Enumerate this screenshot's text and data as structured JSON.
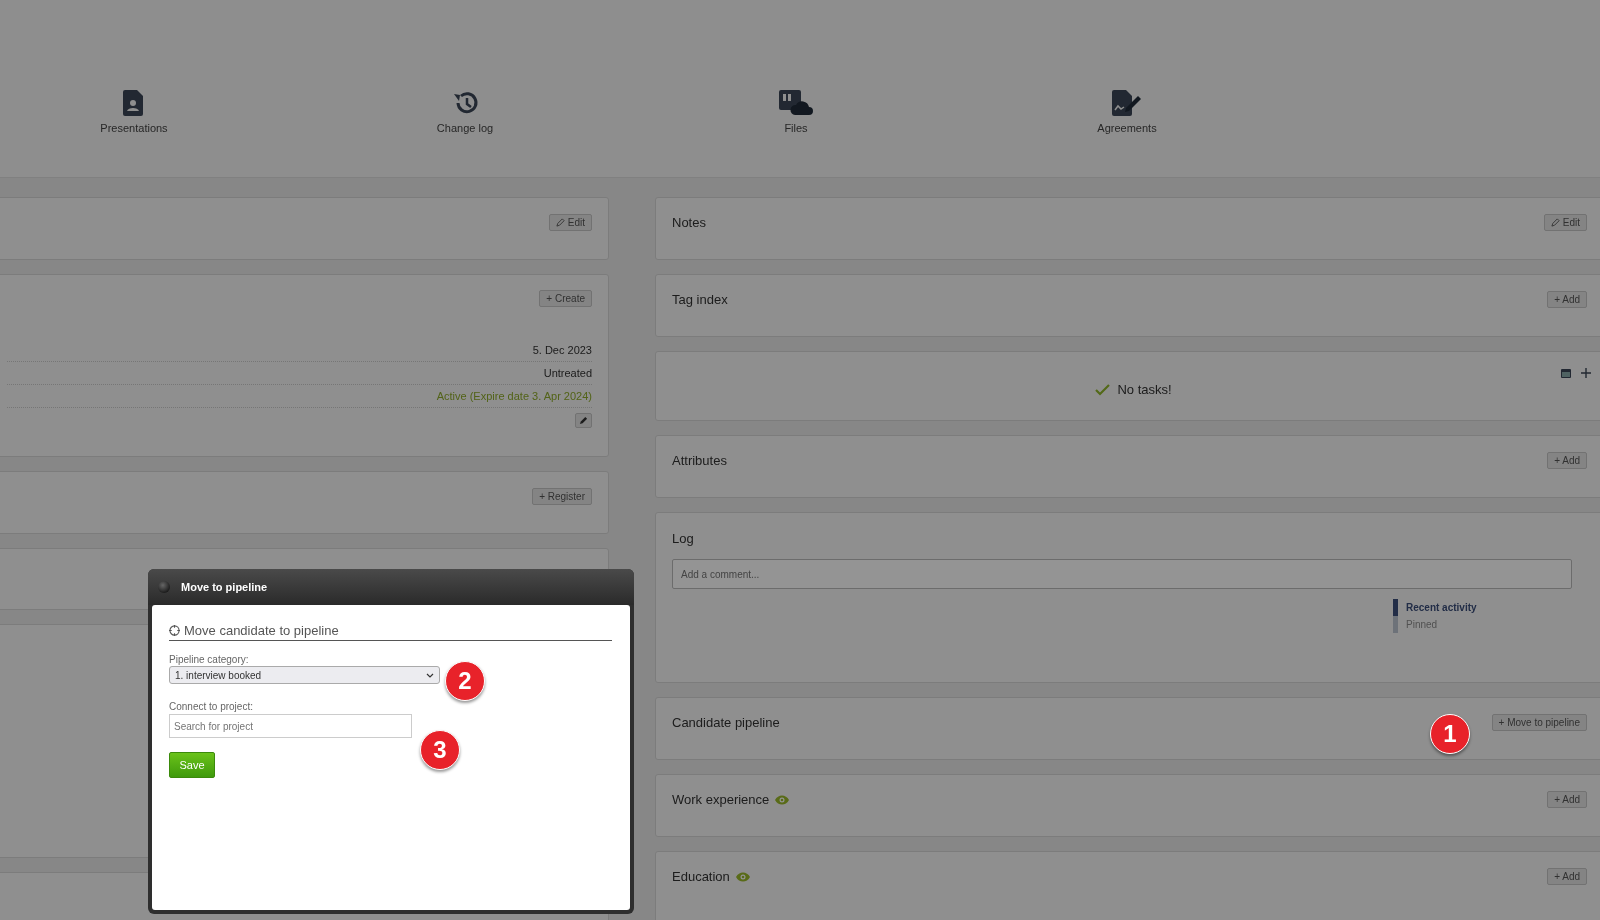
{
  "nav": [
    {
      "label": "Presentations",
      "kind": "person-doc"
    },
    {
      "label": "Change log",
      "kind": "history"
    },
    {
      "label": "Files",
      "kind": "files"
    },
    {
      "label": "Agreements",
      "kind": "signature"
    }
  ],
  "left_panels": [
    {
      "button": {
        "label": "Edit",
        "kind": "edit"
      }
    },
    {
      "button": {
        "label": "+ Create",
        "kind": "add"
      },
      "rows": [
        {
          "text": "5. Dec 2023",
          "kind": "plain"
        },
        {
          "text": "Untreated",
          "kind": "plain"
        },
        {
          "text": "Active (Expire date 3. Apr 2024)",
          "kind": "status"
        },
        {
          "kind": "edit"
        }
      ]
    },
    {
      "button": {
        "label": "+ Register",
        "kind": "add"
      }
    }
  ],
  "right_panels": [
    {
      "kind": "section",
      "title": "Notes",
      "button": {
        "label": "Edit",
        "kind": "edit"
      }
    },
    {
      "kind": "section",
      "title": "Tag index",
      "button": {
        "label": "+ Add",
        "kind": "add"
      }
    },
    {
      "kind": "tasks",
      "message": "No tasks!"
    },
    {
      "kind": "section",
      "title": "Attributes",
      "button": {
        "label": "+ Add",
        "kind": "add"
      }
    },
    {
      "kind": "log",
      "title": "Log",
      "placeholder": "Add a comment...",
      "tabs": [
        {
          "label": "Recent activity",
          "selected": true
        },
        {
          "label": "Pinned",
          "selected": false
        }
      ]
    },
    {
      "kind": "section",
      "title": "Candidate pipeline",
      "button": {
        "label": "+ Move to pipeline",
        "kind": "add"
      }
    },
    {
      "kind": "section",
      "title": "Work experience",
      "visible": true,
      "button": {
        "label": "+ Add",
        "kind": "add"
      }
    },
    {
      "kind": "section",
      "title": "Education",
      "visible": true,
      "button": {
        "label": "+ Add",
        "kind": "add"
      }
    }
  ],
  "modal": {
    "title": "Move to pipeline",
    "heading": "Move candidate to pipeline",
    "category_label": "Pipeline category:",
    "category_value": "1. interview booked",
    "project_label": "Connect to project:",
    "project_placeholder": "Search for project",
    "save": "Save"
  },
  "annotations": [
    {
      "text": "1"
    },
    {
      "text": "2"
    },
    {
      "text": "3"
    }
  ]
}
